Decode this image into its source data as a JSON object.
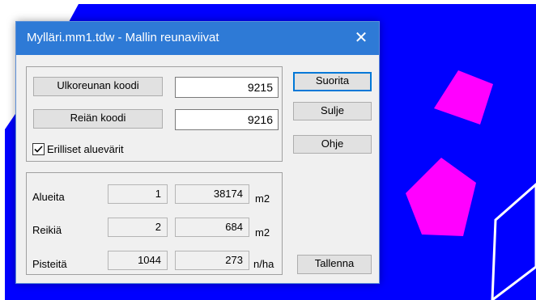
{
  "dialog": {
    "title": "Mylläri.mm1.tdw - Mallin reunaviivat",
    "close_glyph": "✕"
  },
  "codes": {
    "outer_code_label": "Ulkoreunan koodi",
    "outer_code_value": "9215",
    "hole_code_label": "Reiän koodi",
    "hole_code_value": "9216",
    "separate_colors_label": "Erilliset aluevärit",
    "separate_colors_checked": true
  },
  "buttons": {
    "run": "Suorita",
    "close": "Sulje",
    "help": "Ohje",
    "save": "Tallenna"
  },
  "stats": {
    "areas_label": "Alueita",
    "areas_count": "1",
    "areas_value": "38174",
    "areas_unit": "m2",
    "holes_label": "Reikiä",
    "holes_count": "2",
    "holes_value": "684",
    "holes_unit": "m2",
    "points_label": "Pisteitä",
    "points_count": "1044",
    "points_density": "273",
    "points_unit": "n/ha"
  },
  "colors": {
    "model_area": "#0000ff",
    "hole_fill": "#ff00ff",
    "titlebar": "#2e7ad6",
    "default_button_border": "#0078d7"
  }
}
